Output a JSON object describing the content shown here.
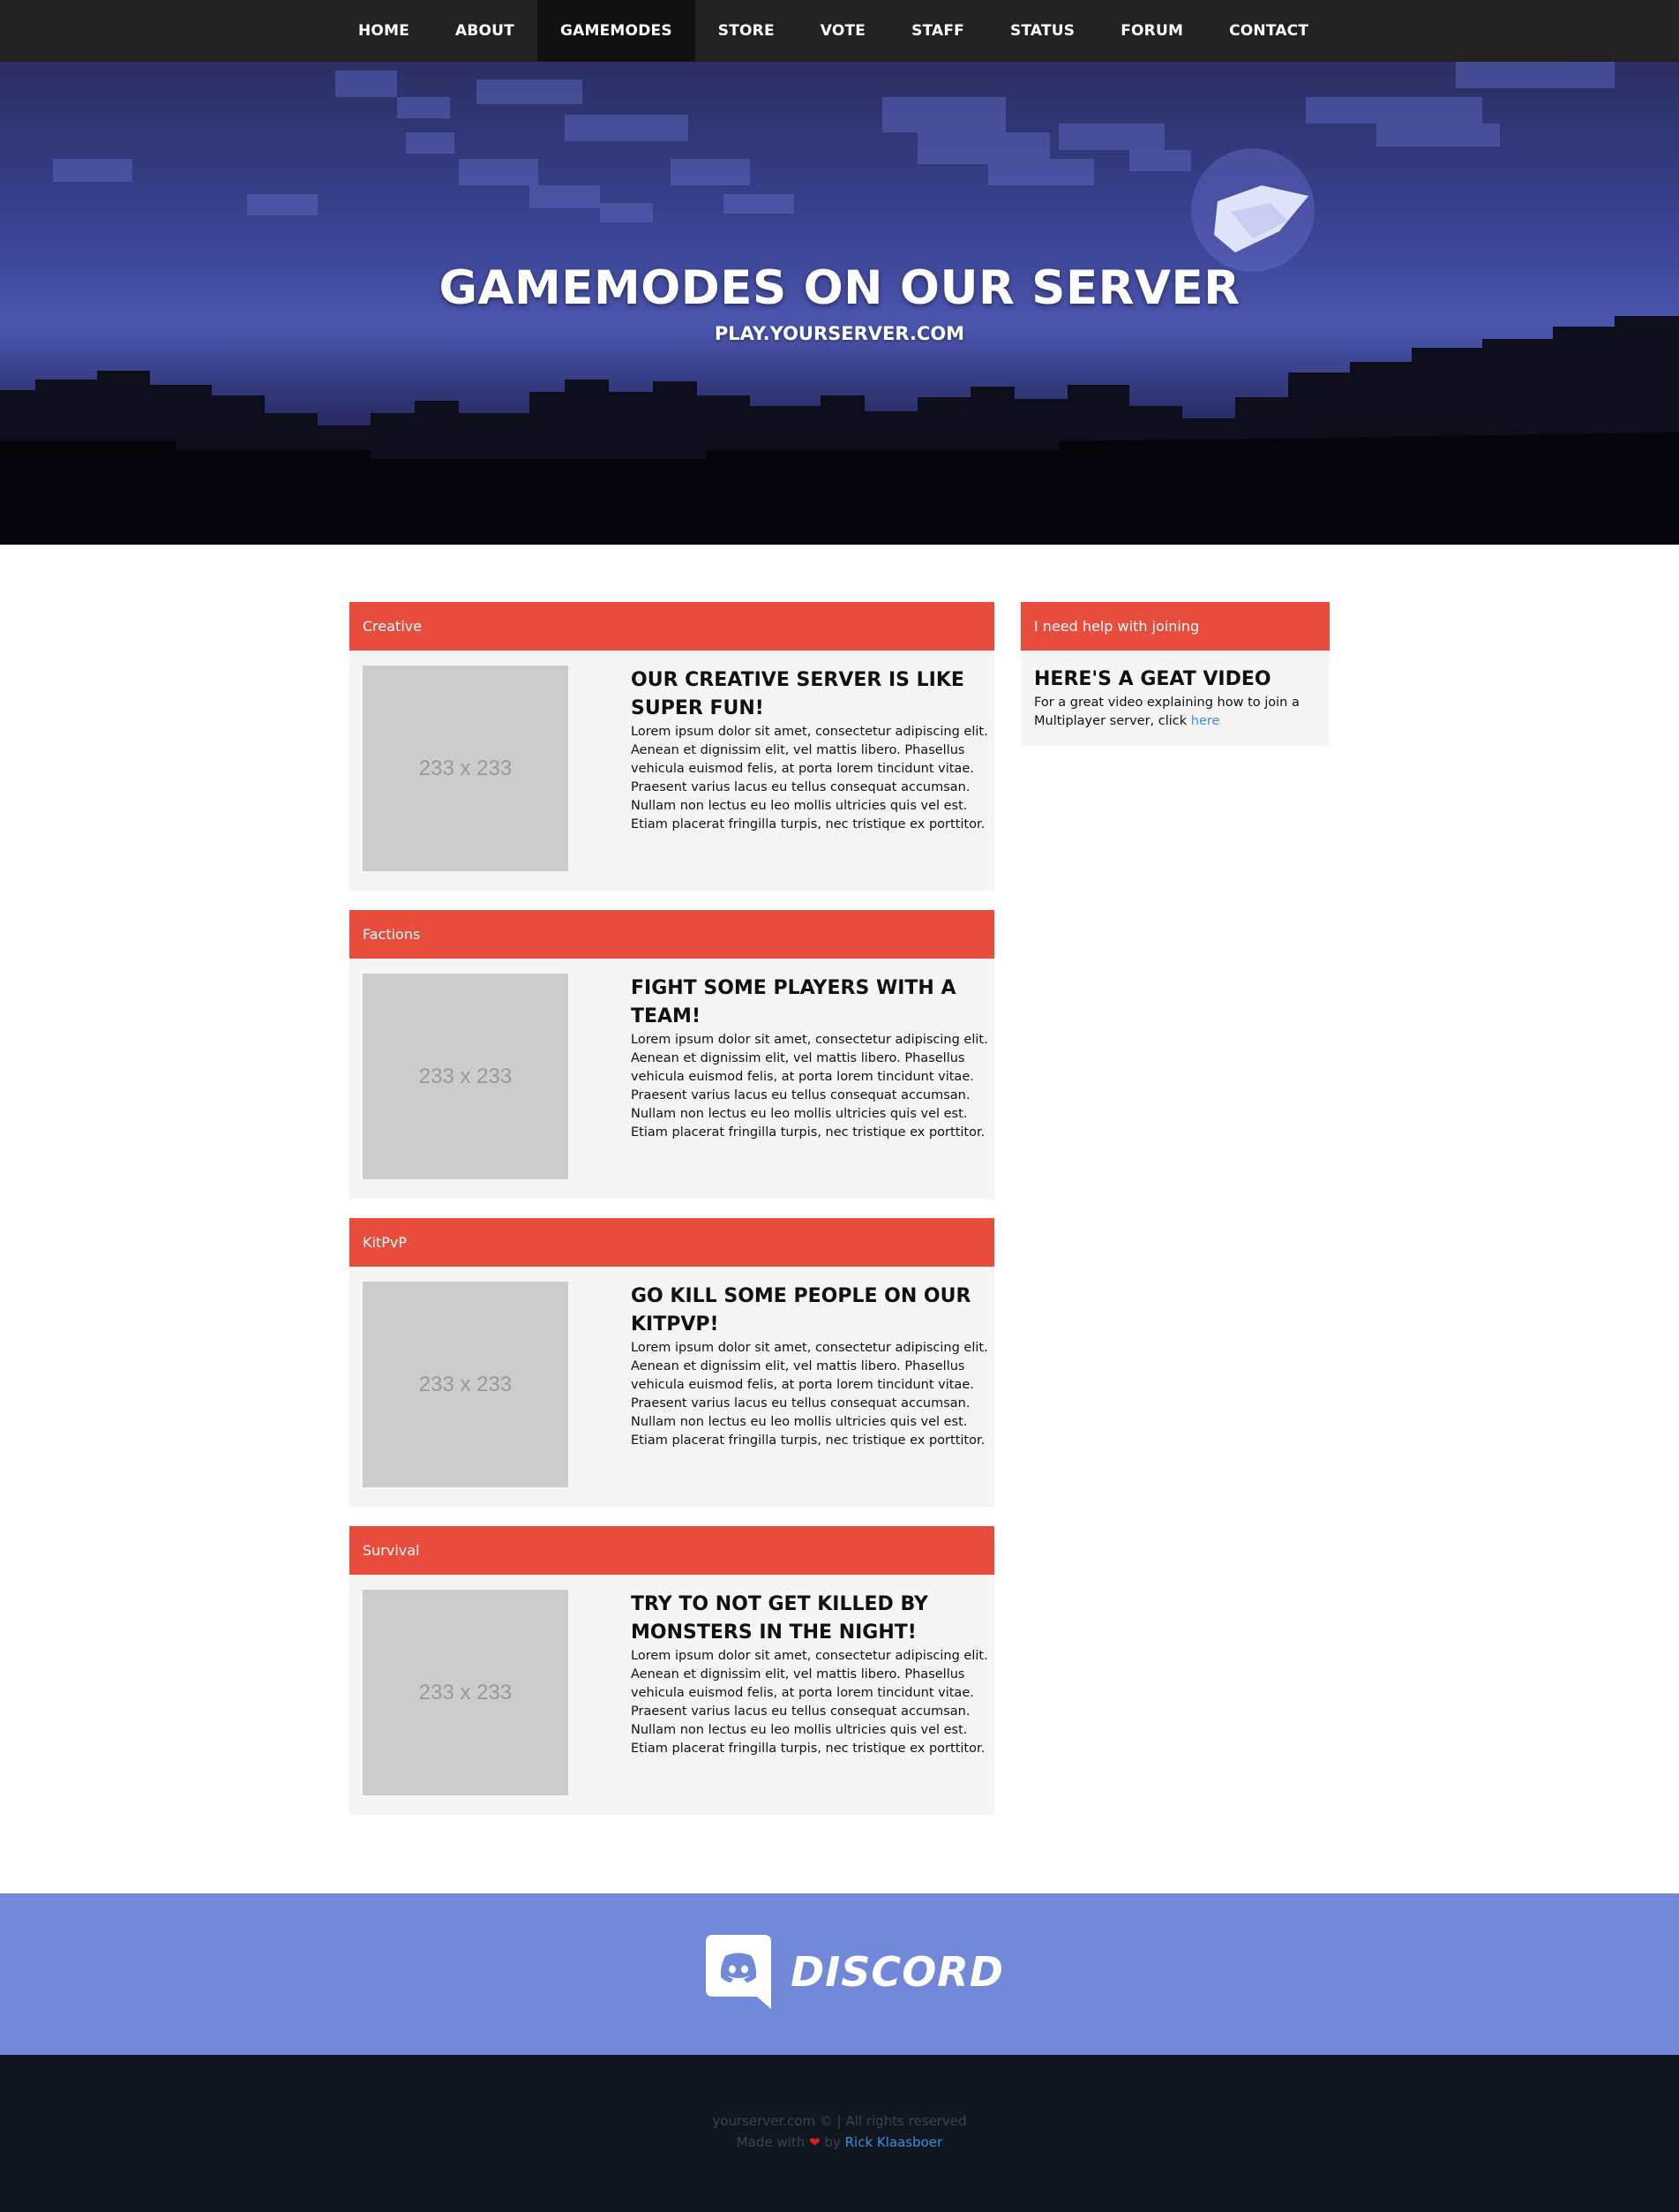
{
  "nav": {
    "items": [
      {
        "label": "HOME"
      },
      {
        "label": "ABOUT"
      },
      {
        "label": "GAMEMODES"
      },
      {
        "label": "STORE"
      },
      {
        "label": "VOTE"
      },
      {
        "label": "STAFF"
      },
      {
        "label": "STATUS"
      },
      {
        "label": "FORUM"
      },
      {
        "label": "CONTACT"
      }
    ],
    "active": "GAMEMODES"
  },
  "hero": {
    "title": "GAMEMODES ON OUR SERVER",
    "subtitle": "PLAY.YOURSERVER.COM"
  },
  "gamemodes": [
    {
      "name": "Creative",
      "image_placeholder": "233 x 233",
      "heading": "OUR CREATIVE SERVER IS LIKE SUPER FUN!",
      "body": "Lorem ipsum dolor sit amet, consectetur adipiscing elit. Aenean et dignissim elit, vel mattis libero. Phasellus vehicula euismod felis, at porta lorem tincidunt vitae. Praesent varius lacus eu tellus consequat accumsan. Nullam non lectus eu leo mollis ultricies quis vel est. Etiam placerat fringilla turpis, nec tristique ex porttitor."
    },
    {
      "name": "Factions",
      "image_placeholder": "233 x 233",
      "heading": "FIGHT SOME PLAYERS WITH A TEAM!",
      "body": "Lorem ipsum dolor sit amet, consectetur adipiscing elit. Aenean et dignissim elit, vel mattis libero. Phasellus vehicula euismod felis, at porta lorem tincidunt vitae. Praesent varius lacus eu tellus consequat accumsan. Nullam non lectus eu leo mollis ultricies quis vel est. Etiam placerat fringilla turpis, nec tristique ex porttitor."
    },
    {
      "name": "KitPvP",
      "image_placeholder": "233 x 233",
      "heading": "GO KILL SOME PEOPLE ON OUR KITPVP!",
      "body": "Lorem ipsum dolor sit amet, consectetur adipiscing elit. Aenean et dignissim elit, vel mattis libero. Phasellus vehicula euismod felis, at porta lorem tincidunt vitae. Praesent varius lacus eu tellus consequat accumsan. Nullam non lectus eu leo mollis ultricies quis vel est. Etiam placerat fringilla turpis, nec tristique ex porttitor."
    },
    {
      "name": "Survival",
      "image_placeholder": "233 x 233",
      "heading": "TRY TO NOT GET KILLED BY MONSTERS IN THE NIGHT!",
      "body": "Lorem ipsum dolor sit amet, consectetur adipiscing elit. Aenean et dignissim elit, vel mattis libero. Phasellus vehicula euismod felis, at porta lorem tincidunt vitae. Praesent varius lacus eu tellus consequat accumsan. Nullam non lectus eu leo mollis ultricies quis vel est. Etiam placerat fringilla turpis, nec tristique ex porttitor."
    }
  ],
  "sidebar": {
    "header": "I need help with joining",
    "heading": "HERE'S A GEAT VIDEO",
    "body": "For a great video explaining how to join a Multiplayer server, click",
    "link": "here"
  },
  "discord": {
    "label": "DISCORD"
  },
  "footer": {
    "copyright": "yourserver.com © | All rights reserved",
    "made_with": "Made with",
    "by": "by",
    "author": "Rick Klaasboer"
  },
  "colors": {
    "nav_bg": "#222222",
    "nav_active": "#111111",
    "panel_header": "#e74c3c",
    "panel_bg": "#f5f5f5",
    "discord": "#7289da",
    "footer_bg": "#111620",
    "link": "#3a8fd8",
    "heart": "#e02020"
  },
  "icons": [
    "heart-icon",
    "discord-icon"
  ]
}
